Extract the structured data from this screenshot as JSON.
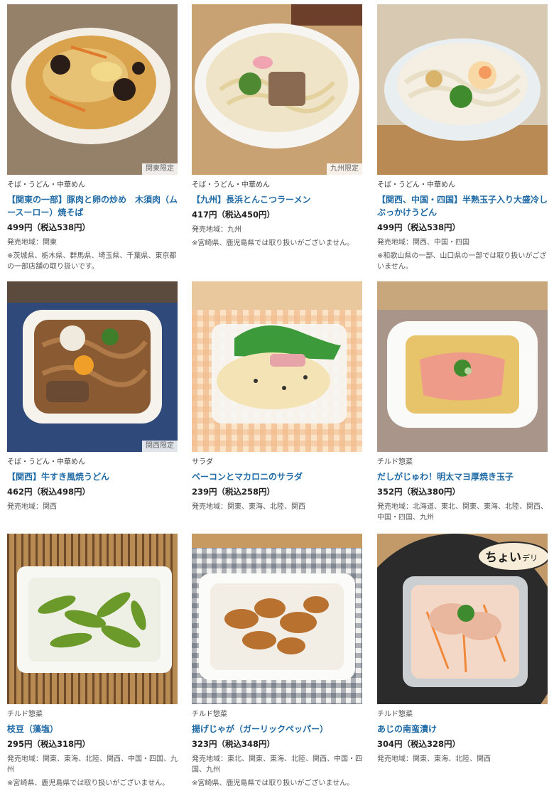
{
  "products": [
    {
      "category": "そば・うどん・中華めん",
      "name": "【関東の一部】豚肉と卵の炒め　木須肉（ムースーロー）焼そば",
      "price": "499円（税込538円）",
      "area": "発売地域：関東",
      "note": "※茨城県、栃木県、群馬県、埼玉県、千葉県、東京都の一部店舗の取り扱いです。",
      "badge": "関東限定",
      "image_icon": "yakisoba-photo"
    },
    {
      "category": "そば・うどん・中華めん",
      "name": "【九州】長浜とんこつラーメン",
      "price": "417円（税込450円）",
      "area": "発売地域：九州",
      "note": "※宮崎県、鹿児島県では取り扱いがございません。",
      "badge": "九州限定",
      "image_icon": "ramen-photo"
    },
    {
      "category": "そば・うどん・中華めん",
      "name": "【関西、中国・四国】半熟玉子入り大盛冷しぶっかけうどん",
      "price": "499円（税込538円）",
      "area": "発売地域：関西、中国・四国",
      "note": "※和歌山県の一部、山口県の一部では取り扱いがございません。",
      "badge": "",
      "image_icon": "udon-photo"
    },
    {
      "category": "そば・うどん・中華めん",
      "name": "【関西】牛すき風焼うどん",
      "price": "462円（税込498円）",
      "area": "発売地域：関西",
      "note": "",
      "badge": "関西限定",
      "image_icon": "yaki-udon-photo"
    },
    {
      "category": "サラダ",
      "name": "ベーコンとマカロニのサラダ",
      "price": "239円（税込258円）",
      "area": "発売地域：関東、東海、北陸、関西",
      "note": "",
      "badge": "",
      "image_icon": "salad-photo"
    },
    {
      "category": "チルド惣菜",
      "name": "だしがじゅわ！明太マヨ厚焼き玉子",
      "price": "352円（税込380円）",
      "area": "発売地域：北海道、東北、関東、東海、北陸、関西、中国・四国、九州",
      "note": "",
      "badge": "",
      "image_icon": "tamagoyaki-photo"
    },
    {
      "category": "チルド惣菜",
      "name": "枝豆（藻塩）",
      "price": "295円（税込318円）",
      "area": "発売地域：関東、東海、北陸、関西、中国・四国、九州",
      "note": "※宮崎県、鹿児島県では取り扱いがございません。",
      "badge": "",
      "image_icon": "edamame-photo"
    },
    {
      "category": "チルド惣菜",
      "name": "揚げじゃが（ガーリックペッパー）",
      "price": "323円（税込348円）",
      "area": "発売地域：東北、関東、東海、北陸、関西、中国・四国、九州",
      "note": "※宮崎県、鹿児島県では取り扱いがございません。",
      "badge": "",
      "image_icon": "potato-photo"
    },
    {
      "category": "チルド惣菜",
      "name": "あじの南蛮漬け",
      "price": "304円（税込328円）",
      "area": "発売地域：関東、東海、北陸、関西",
      "note": "",
      "badge": "",
      "image_icon": "nanban-photo",
      "sticker": {
        "big": "ちょい",
        "small": "デリ"
      }
    }
  ]
}
